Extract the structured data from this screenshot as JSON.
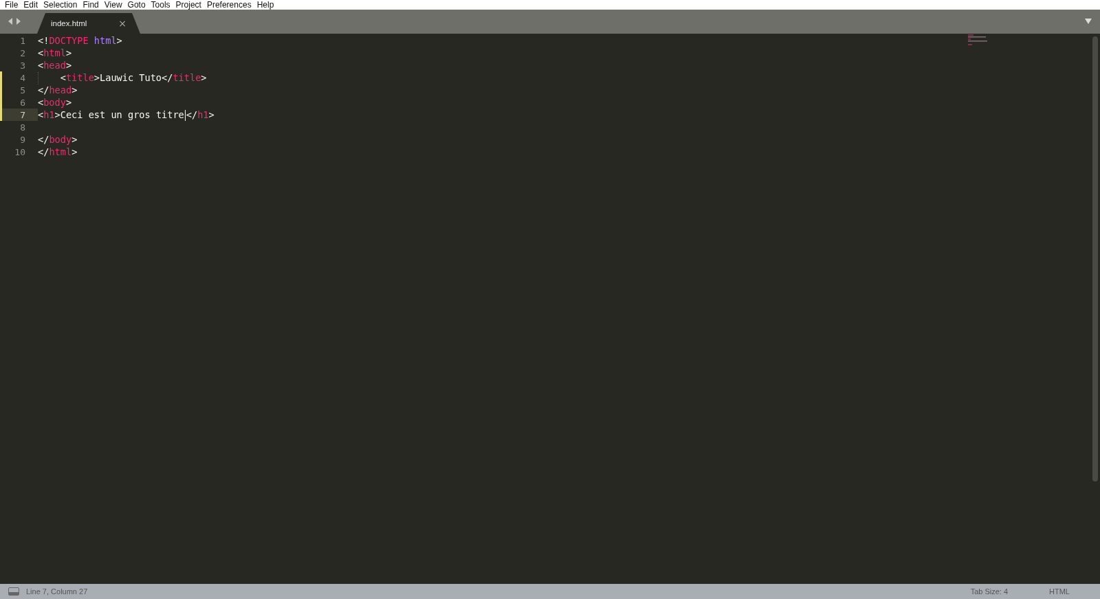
{
  "menu_bar": [
    "File",
    "Edit",
    "Selection",
    "Find",
    "View",
    "Goto",
    "Tools",
    "Project",
    "Preferences",
    "Help"
  ],
  "tabs": [
    {
      "label": "index.html",
      "selected": true,
      "close": "×"
    }
  ],
  "editor": {
    "lines": [
      {
        "number": "1",
        "modified": false,
        "current": false,
        "tokens": [
          {
            "kind": "punct",
            "text": "<!"
          },
          {
            "kind": "tag",
            "text": "DOCTYPE"
          },
          {
            "kind": "attr",
            "text": " html"
          },
          {
            "kind": "punct",
            "text": ">"
          }
        ]
      },
      {
        "number": "2",
        "modified": false,
        "current": false,
        "tokens": [
          {
            "kind": "punct",
            "text": "<"
          },
          {
            "kind": "tag",
            "text": "html"
          },
          {
            "kind": "punct",
            "text": ">"
          }
        ]
      },
      {
        "number": "3",
        "modified": false,
        "current": false,
        "tokens": [
          {
            "kind": "punct",
            "text": "<"
          },
          {
            "kind": "tag",
            "text": "head"
          },
          {
            "kind": "punct",
            "text": ">"
          }
        ]
      },
      {
        "number": "4",
        "modified": true,
        "current": false,
        "tokens": [
          {
            "kind": "indent"
          },
          {
            "kind": "punct",
            "text": "<"
          },
          {
            "kind": "tag",
            "text": "title"
          },
          {
            "kind": "punct",
            "text": ">"
          },
          {
            "kind": "text",
            "text": "Lauwic Tuto"
          },
          {
            "kind": "punct",
            "text": "</"
          },
          {
            "kind": "tag",
            "text": "title"
          },
          {
            "kind": "punct",
            "text": ">"
          }
        ]
      },
      {
        "number": "5",
        "modified": true,
        "current": false,
        "tokens": [
          {
            "kind": "punct",
            "text": "</"
          },
          {
            "kind": "tag",
            "text": "head"
          },
          {
            "kind": "punct",
            "text": ">"
          }
        ]
      },
      {
        "number": "6",
        "modified": true,
        "current": false,
        "tokens": [
          {
            "kind": "punct",
            "text": "<"
          },
          {
            "kind": "tag",
            "text": "body"
          },
          {
            "kind": "punct",
            "text": ">"
          }
        ]
      },
      {
        "number": "7",
        "modified": true,
        "current": true,
        "tokens": [
          {
            "kind": "punct",
            "text": "<"
          },
          {
            "kind": "tag",
            "text": "h1"
          },
          {
            "kind": "punct",
            "text": ">"
          },
          {
            "kind": "text",
            "text": "Ceci est un gros titre"
          },
          {
            "kind": "cursor"
          },
          {
            "kind": "punct",
            "text": "</"
          },
          {
            "kind": "tag",
            "text": "h1"
          },
          {
            "kind": "punct",
            "text": ">"
          }
        ]
      },
      {
        "number": "8",
        "modified": false,
        "current": false
      },
      {
        "number": "9",
        "modified": false,
        "current": false,
        "tokens": [
          {
            "kind": "punct",
            "text": "</"
          },
          {
            "kind": "tag",
            "text": "body"
          },
          {
            "kind": "punct",
            "text": ">"
          }
        ]
      },
      {
        "number": "10",
        "modified": false,
        "current": false,
        "tokens": [
          {
            "kind": "punct",
            "text": "</"
          },
          {
            "kind": "tag",
            "text": "html"
          },
          {
            "kind": "punct",
            "text": ">"
          }
        ]
      }
    ]
  },
  "status_bar": {
    "position": "Line 7, Column 27",
    "tab_size": "Tab Size: 4",
    "syntax": "HTML"
  }
}
